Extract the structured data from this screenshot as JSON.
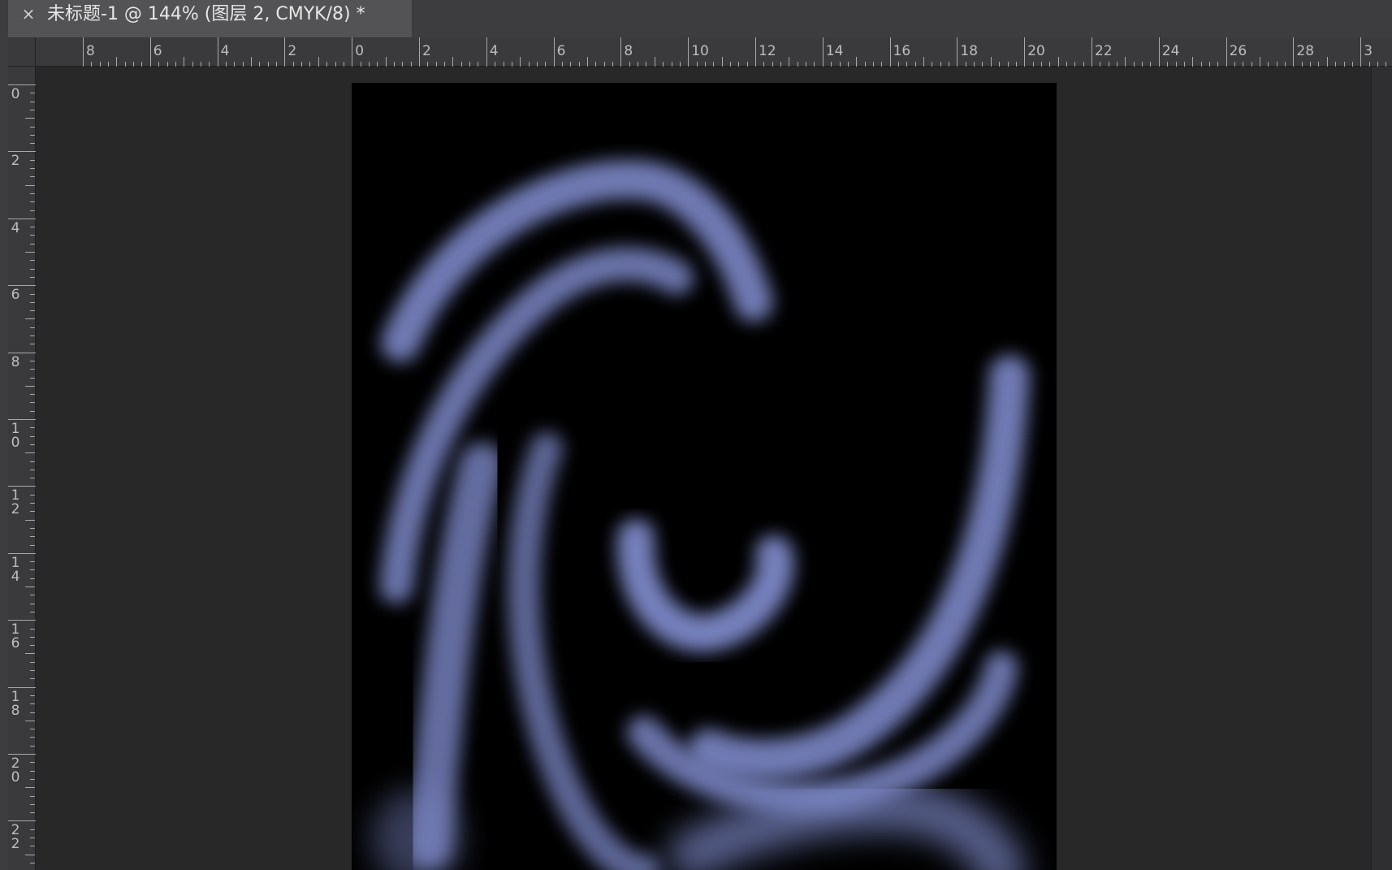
{
  "document_tab": {
    "title": "未标题-1 @ 144% (图层 2, CMYK/8) *",
    "close_glyph": "×"
  },
  "ruler_horizontal": {
    "labels": [
      "8",
      "6",
      "4",
      "2",
      "0",
      "2",
      "4",
      "6",
      "8",
      "10",
      "12",
      "14",
      "16",
      "18",
      "20",
      "22",
      "24",
      "26",
      "28",
      "3"
    ]
  },
  "ruler_vertical": {
    "labels": [
      "0",
      "2",
      "4",
      "6",
      "8",
      "10",
      "12",
      "14",
      "16",
      "18",
      "20",
      "22"
    ]
  },
  "colors": {
    "workspace": "#282828",
    "tab_bar": "#3d3d3f",
    "active_tab": "#535355",
    "ruler": "#3a3a3c",
    "document_background": "#000000",
    "swirl_color": "#7d88c7"
  },
  "artwork": {
    "description_icon": "swirl-artwork"
  }
}
